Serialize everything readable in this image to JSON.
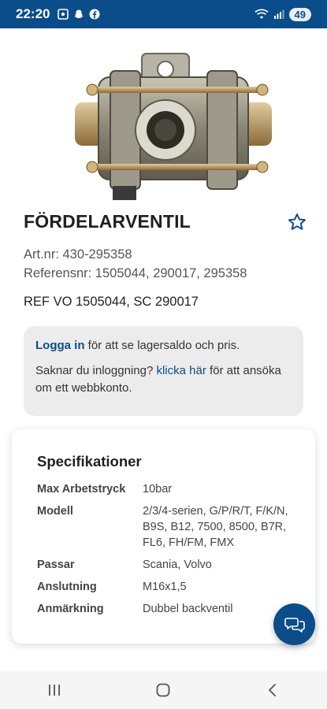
{
  "status_bar": {
    "time": "22:20",
    "battery": "49",
    "icons": [
      "screenshot-icon",
      "snapchat-icon",
      "facebook-icon",
      "wifi-icon",
      "signal-icon"
    ]
  },
  "product": {
    "title": "FÖRDELARVENTIL",
    "art_nr": "Art.nr: 430-295358",
    "ref_nr": "Referensnr: 1505044, 290017, 295358",
    "ref_line": "REF VO 1505044, SC 290017",
    "image_icon": "valve-product-image"
  },
  "login": {
    "link_label": "Logga in",
    "line1_rest": " för att se lagersaldo och pris.",
    "line2_pre": "Saknar du inloggning? ",
    "line2_link": "klicka här",
    "line2_post": " för att ansöka om ett webbkonto."
  },
  "specs": {
    "title": "Specifikationer",
    "rows": [
      {
        "key": "Max Arbetstryck",
        "value": "10bar"
      },
      {
        "key": "Modell",
        "value": "2/3/4-serien, G/P/R/T, F/K/N, B9S, B12, 7500, 8500, B7R, FL6, FH/FM, FMX"
      },
      {
        "key": "Passar",
        "value": "Scania, Volvo"
      },
      {
        "key": "Anslutning",
        "value": "M16x1,5"
      },
      {
        "key": "Anmärkning",
        "value": "Dubbel backventil"
      }
    ]
  },
  "colors": {
    "brand": "#0b4c8a",
    "box_bg": "#ececec"
  }
}
